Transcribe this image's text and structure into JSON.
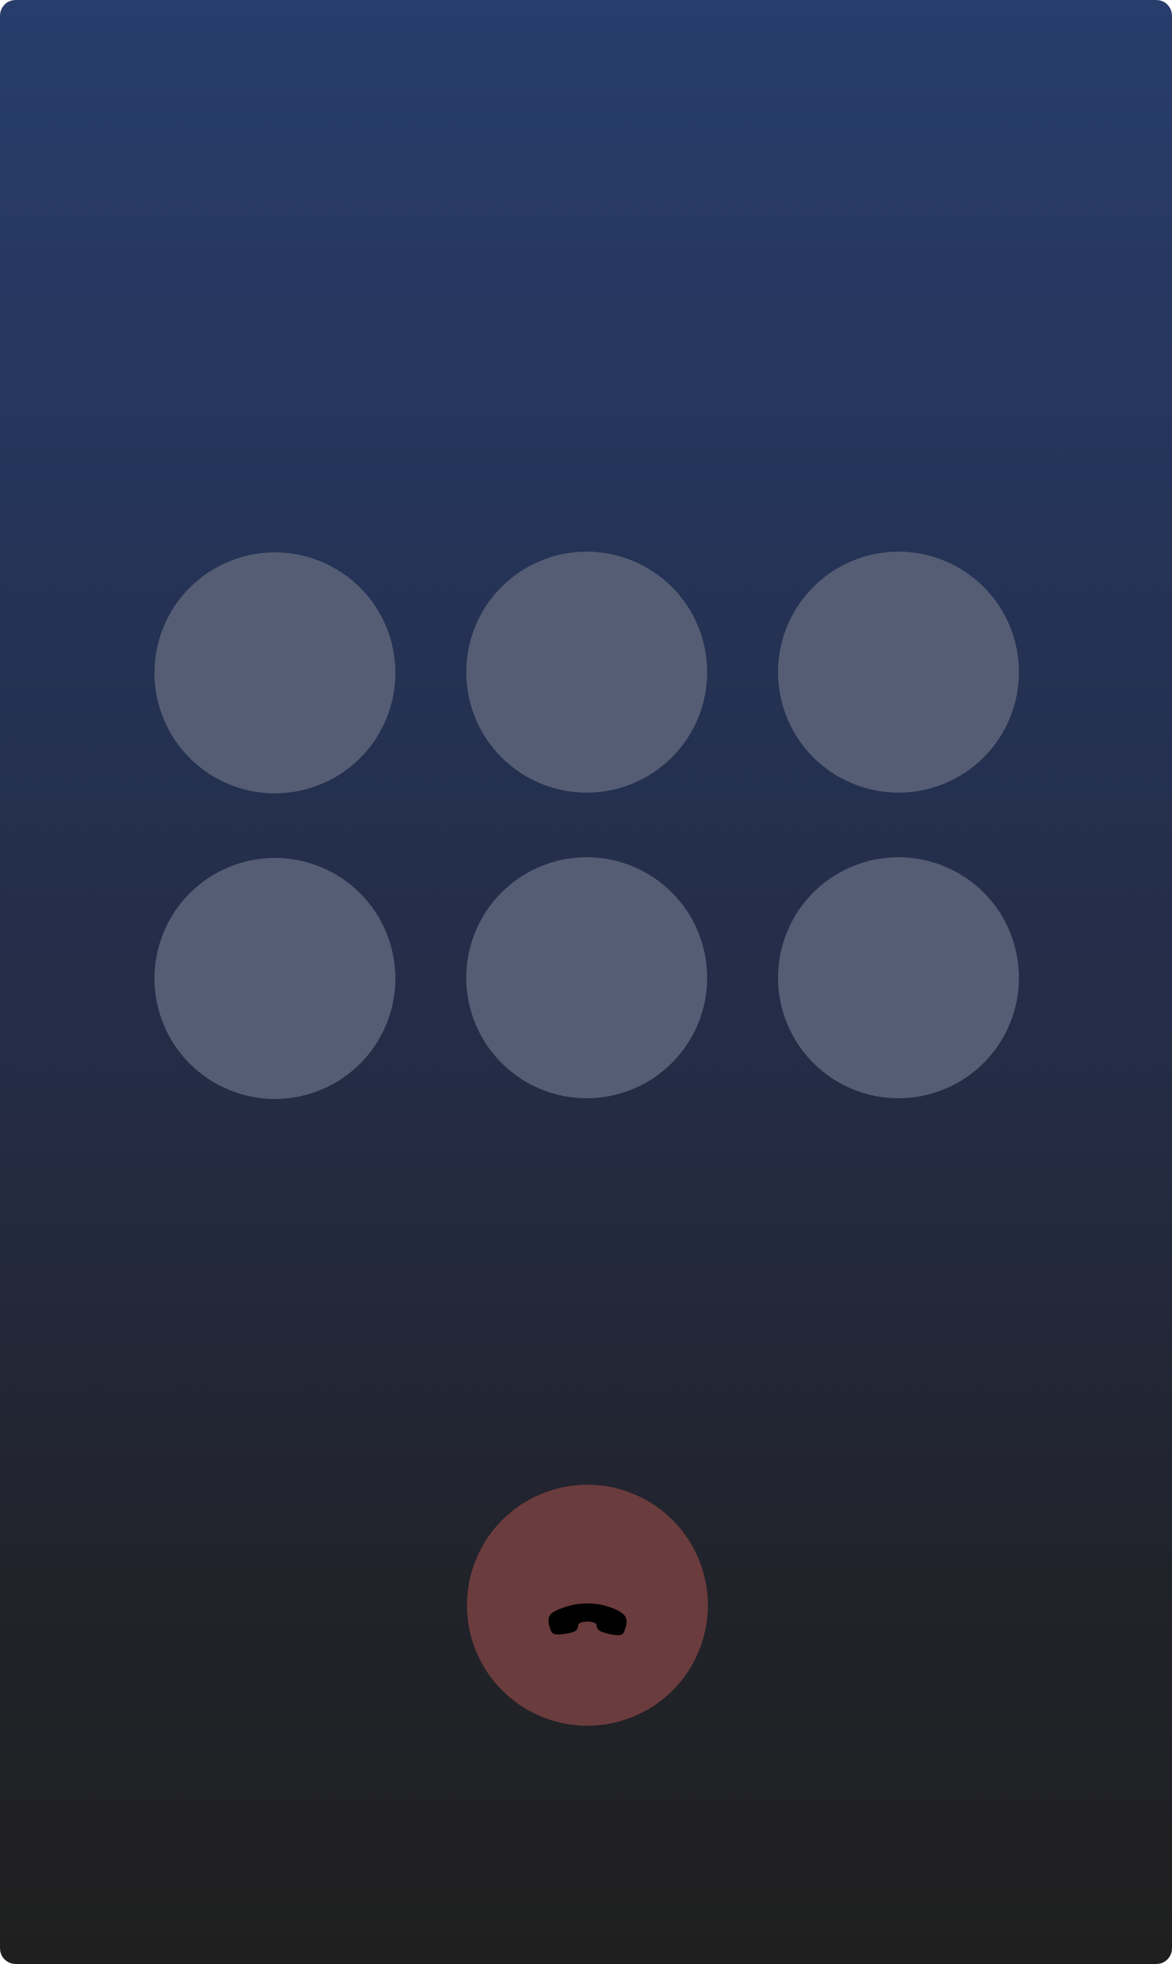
{
  "screen": {
    "name": "in-call-screen"
  },
  "controls": {
    "buttons": [
      {
        "id": "call-control-1",
        "label": "",
        "icon": ""
      },
      {
        "id": "call-control-2",
        "label": "",
        "icon": ""
      },
      {
        "id": "call-control-3",
        "label": "",
        "icon": ""
      },
      {
        "id": "call-control-4",
        "label": "",
        "icon": ""
      },
      {
        "id": "call-control-5",
        "label": "",
        "icon": ""
      },
      {
        "id": "call-control-6",
        "label": "",
        "icon": ""
      }
    ]
  },
  "end_call": {
    "icon": "phone-hangup-icon",
    "color": "#6b3c3d",
    "icon_color": "#000000"
  },
  "colors": {
    "background_top": "#283d6c",
    "background_bottom": "#1f1f1f",
    "control_button": "#545d73",
    "end_call_button": "#6b3c3d"
  }
}
